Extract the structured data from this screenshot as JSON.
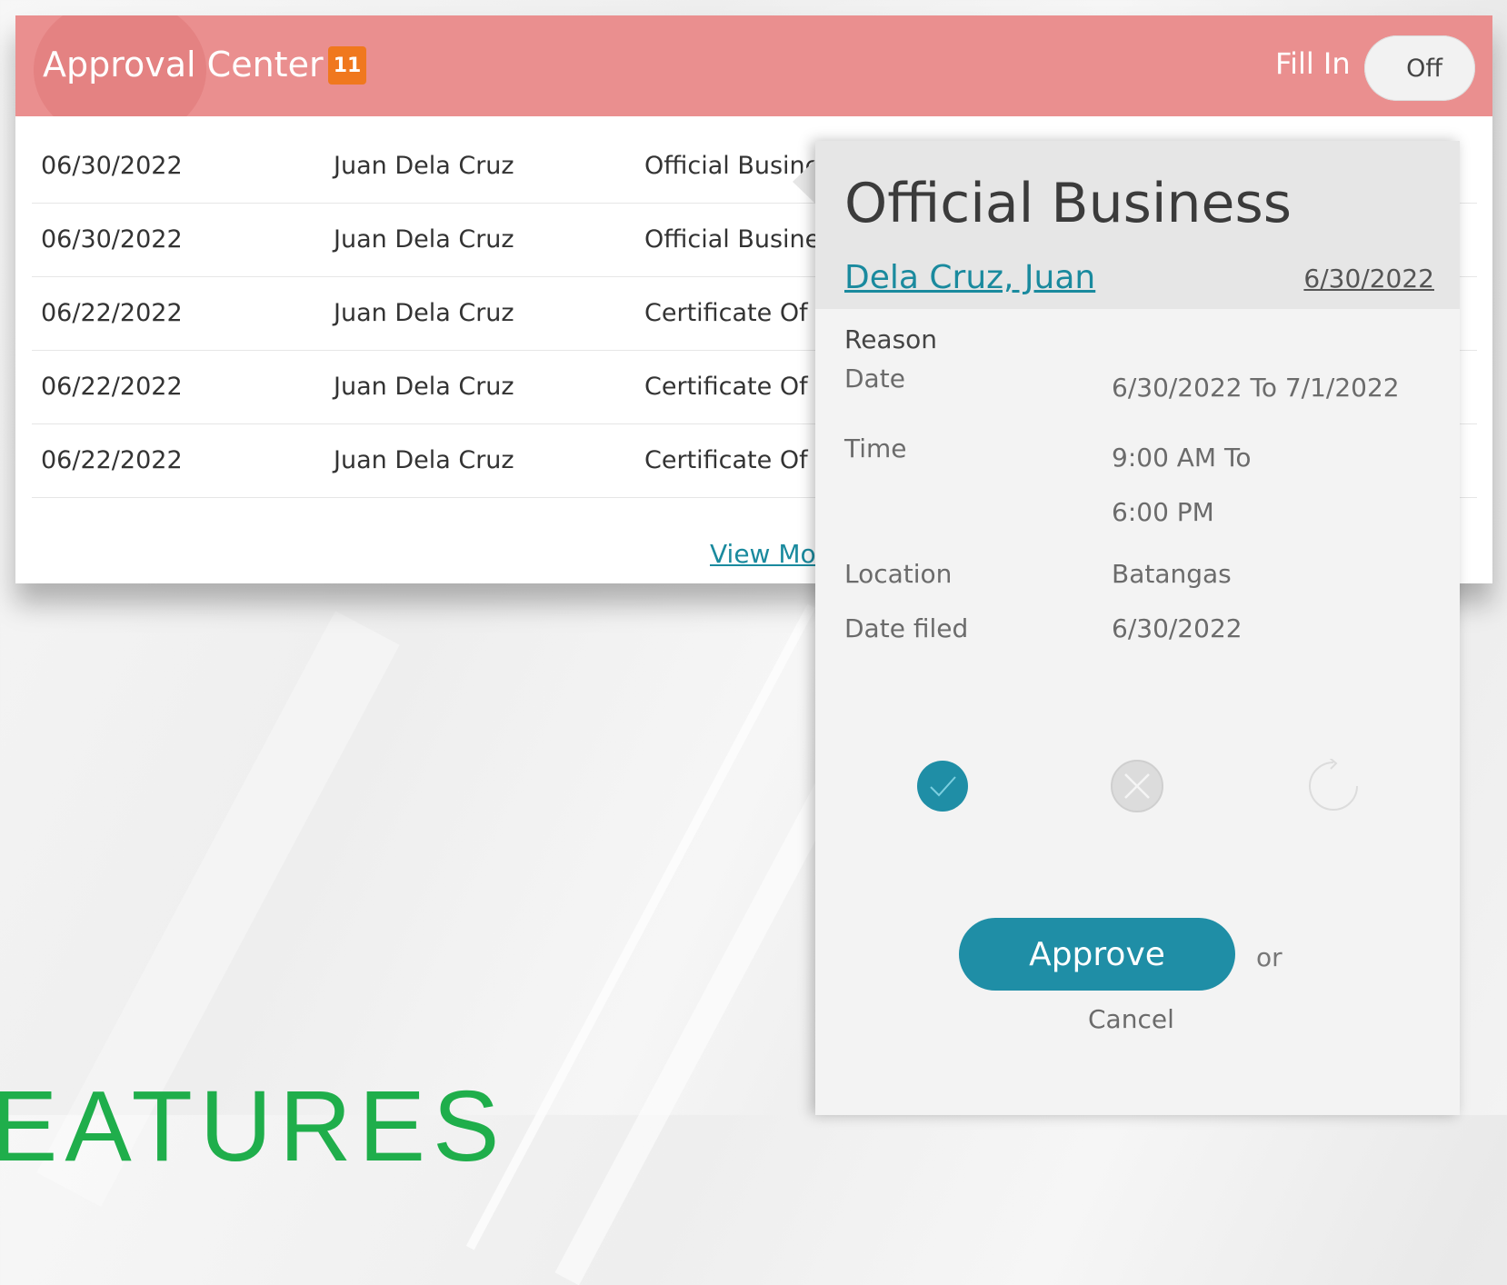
{
  "header": {
    "title": "Approval Center",
    "badge_count": "11",
    "fill_in_label": "Fill In",
    "toggle_state": "Off"
  },
  "rows": [
    {
      "date": "06/30/2022",
      "name": "Juan Dela Cruz",
      "type": "Official Busine"
    },
    {
      "date": "06/30/2022",
      "name": "Juan Dela Cruz",
      "type": "Official Business"
    },
    {
      "date": "06/22/2022",
      "name": "Juan Dela Cruz",
      "type": "Certificate Of At"
    },
    {
      "date": "06/22/2022",
      "name": "Juan Dela Cruz",
      "type": "Certificate Of At"
    },
    {
      "date": "06/22/2022",
      "name": "Juan Dela Cruz",
      "type": "Certificate Of At"
    }
  ],
  "view_more_label": "View More",
  "popover": {
    "title": "Official Business",
    "employee_name": "Dela Cruz, Juan",
    "date": "6/30/2022",
    "reason_label": "Reason",
    "date_label": "Date",
    "date_value": "6/30/2022 To 7/1/2022",
    "time_label": "Time",
    "time_value_1": "9:00 AM To",
    "time_value_2": "6:00 PM",
    "location_label": "Location",
    "location_value": "Batangas",
    "date_filed_label": "Date filed",
    "date_filed_value": "6/30/2022",
    "approve_label": "Approve",
    "or_label": "or",
    "cancel_label": "Cancel"
  },
  "background_text": "EATURES",
  "colors": {
    "header": "#ea8f8f",
    "badge": "#f0781e",
    "accent": "#1f8ea6",
    "background_text": "#1fae4b"
  }
}
